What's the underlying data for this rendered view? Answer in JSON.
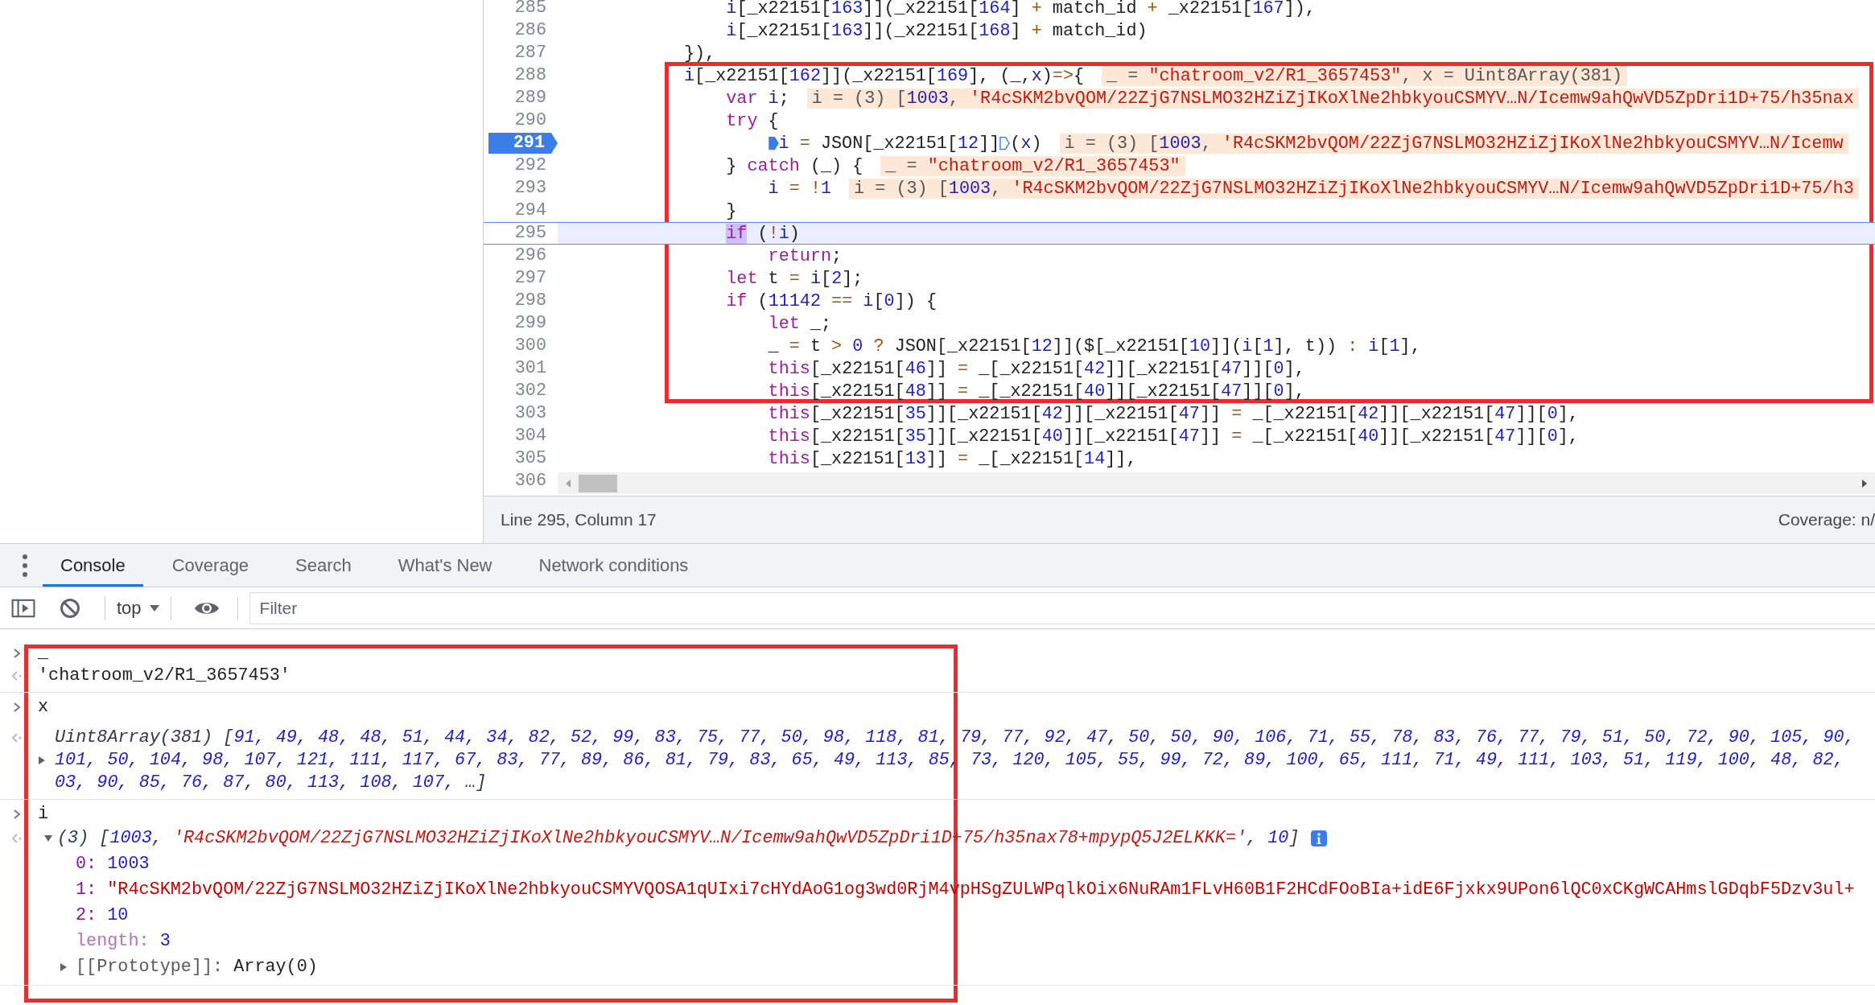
{
  "editor": {
    "lines": [
      {
        "children": [
          {
            "number": "285",
            "breakpoint": false,
            "current": false,
            "segments": [
              {
                "kind": "code",
                "tokens": [
                  {
                    "kind": "name",
                    "text": "i"
                  },
                  {
                    "kind": "plain",
                    "text": "[_x22151["
                  },
                  {
                    "kind": "num",
                    "text": "163"
                  },
                  {
                    "kind": "plain",
                    "text": "]](_x22151["
                  },
                  {
                    "kind": "num",
                    "text": "164"
                  },
                  {
                    "kind": "plain",
                    "text": "] "
                  },
                  {
                    "kind": "op",
                    "text": "+"
                  },
                  {
                    "kind": "plain",
                    "text": " match_id "
                  },
                  {
                    "kind": "op",
                    "text": "+"
                  },
                  {
                    "kind": "plain",
                    "text": " _x22151["
                  },
                  {
                    "kind": "num",
                    "text": "167"
                  },
                  {
                    "kind": "plain",
                    "text": "]),"
                  }
                ]
              }
            ]
          },
          {
            "number": "286",
            "breakpoint": false,
            "current": false,
            "segments": [
              {
                "kind": "code",
                "tokens": [
                  {
                    "kind": "name",
                    "text": "i"
                  },
                  {
                    "kind": "plain",
                    "text": "[_x22151["
                  },
                  {
                    "kind": "num",
                    "text": "163"
                  },
                  {
                    "kind": "plain",
                    "text": "]](_x22151["
                  },
                  {
                    "kind": "num",
                    "text": "168"
                  },
                  {
                    "kind": "plain",
                    "text": "] "
                  },
                  {
                    "kind": "op",
                    "text": "+"
                  },
                  {
                    "kind": "plain",
                    "text": " match_id)"
                  }
                ]
              }
            ]
          }
        ]
      },
      {
        "number": "287",
        "breakpoint": false,
        "current": false,
        "segments": [
          {
            "kind": "code",
            "tokens": [
              {
                "kind": "plain",
                "text": "}),"
              }
            ]
          }
        ]
      },
      {
        "number": "288",
        "breakpoint": false,
        "current": false,
        "segments": [
          {
            "kind": "code",
            "tokens": [
              {
                "kind": "name",
                "text": "i"
              },
              {
                "kind": "plain",
                "text": "[_x22151["
              },
              {
                "kind": "num",
                "text": "162"
              },
              {
                "kind": "plain",
                "text": "]](_x22151["
              },
              {
                "kind": "num",
                "text": "169"
              },
              {
                "kind": "plain",
                "text": "], (_,"
              },
              {
                "kind": "name",
                "text": "x"
              },
              {
                "kind": "plain",
                "text": ")"
              },
              {
                "kind": "op",
                "text": "=>"
              },
              {
                "kind": "plain",
                "text": "{"
              }
            ]
          }
        ],
        "inline_value": [
          {
            "kind": "plain",
            "text": "_ = "
          },
          {
            "kind": "str",
            "text": "\"chatroom_v2/R1_3657453\""
          },
          {
            "kind": "plain",
            "text": ", x = Uint8Array(381)"
          }
        ],
        "children": [
          {
            "number": "289",
            "breakpoint": false,
            "current": false,
            "segments": [
              {
                "kind": "code",
                "tokens": [
                  {
                    "kind": "kw",
                    "text": "var"
                  },
                  {
                    "kind": "name",
                    "text": " i"
                  },
                  {
                    "kind": "plain",
                    "text": ";"
                  }
                ]
              }
            ],
            "inline_value": [
              {
                "kind": "plain",
                "text": "i = (3) ["
              },
              {
                "kind": "num",
                "text": "1003"
              },
              {
                "kind": "plain",
                "text": ", "
              },
              {
                "kind": "str",
                "text": "'R4cSKM2bvQOM/22ZjG7NSLMO32HZiZjIKoXlNe2hbkyouCSMYV…N/Icemw9ahQwVD5ZpDri1D+75/h35nax"
              }
            ]
          },
          {
            "number": "290",
            "breakpoint": false,
            "current": false,
            "segments": [
              {
                "kind": "code",
                "tokens": [
                  {
                    "kind": "kw",
                    "text": "try"
                  },
                  {
                    "kind": "plain",
                    "text": " {"
                  }
                ]
              }
            ],
            "children": [
              {
                "number": "291",
                "breakpoint": true,
                "current": false,
                "segments": [
                  {
                    "kind": "marker",
                    "active": true
                  },
                  {
                    "kind": "code",
                    "tokens": [
                      {
                        "kind": "name",
                        "text": "i"
                      },
                      {
                        "kind": "op",
                        "text": " = "
                      },
                      {
                        "kind": "plain",
                        "text": "JSON[_x22151["
                      },
                      {
                        "kind": "num",
                        "text": "12"
                      },
                      {
                        "kind": "plain",
                        "text": "]]"
                      }
                    ]
                  },
                  {
                    "kind": "marker",
                    "active": false
                  },
                  {
                    "kind": "code",
                    "tokens": [
                      {
                        "kind": "plain",
                        "text": "("
                      },
                      {
                        "kind": "name",
                        "text": "x"
                      },
                      {
                        "kind": "plain",
                        "text": ")"
                      }
                    ]
                  }
                ],
                "inline_value": [
                  {
                    "kind": "plain",
                    "text": "i = (3) ["
                  },
                  {
                    "kind": "num",
                    "text": "1003"
                  },
                  {
                    "kind": "plain",
                    "text": ", "
                  },
                  {
                    "kind": "str",
                    "text": "'R4cSKM2bvQOM/22ZjG7NSLMO32HZiZjIKoXlNe2hbkyouCSMYV…N/Icemw"
                  }
                ]
              }
            ]
          },
          {
            "number": "292",
            "breakpoint": false,
            "current": false,
            "segments": [
              {
                "kind": "code",
                "tokens": [
                  {
                    "kind": "plain",
                    "text": "} "
                  },
                  {
                    "kind": "kw",
                    "text": "catch"
                  },
                  {
                    "kind": "plain",
                    "text": " (_) {"
                  }
                ]
              }
            ],
            "inline_value": [
              {
                "kind": "plain",
                "text": "_ = "
              },
              {
                "kind": "str",
                "text": "\"chatroom_v2/R1_3657453\""
              }
            ],
            "children": [
              {
                "number": "293",
                "breakpoint": false,
                "current": false,
                "segments": [
                  {
                    "kind": "code",
                    "tokens": [
                      {
                        "kind": "name",
                        "text": "i"
                      },
                      {
                        "kind": "op",
                        "text": " = !"
                      },
                      {
                        "kind": "num",
                        "text": "1"
                      }
                    ]
                  }
                ],
                "inline_value": [
                  {
                    "kind": "plain",
                    "text": "i = (3) ["
                  },
                  {
                    "kind": "num",
                    "text": "1003"
                  },
                  {
                    "kind": "plain",
                    "text": ", "
                  },
                  {
                    "kind": "str",
                    "text": "'R4cSKM2bvQOM/22ZjG7NSLMO32HZiZjIKoXlNe2hbkyouCSMYV…N/Icemw9ahQwVD5ZpDri1D+75/h3"
                  }
                ]
              }
            ]
          },
          {
            "number": "294",
            "breakpoint": false,
            "current": false,
            "segments": [
              {
                "kind": "code",
                "tokens": [
                  {
                    "kind": "plain",
                    "text": "}"
                  }
                ]
              }
            ]
          },
          {
            "number": "295",
            "breakpoint": false,
            "current": true,
            "segments": [
              {
                "kind": "code",
                "tokens": [
                  {
                    "kind": "paused",
                    "text": "if"
                  },
                  {
                    "kind": "plain",
                    "text": " ("
                  },
                  {
                    "kind": "op",
                    "text": "!"
                  },
                  {
                    "kind": "name",
                    "text": "i"
                  },
                  {
                    "kind": "plain",
                    "text": ")"
                  }
                ]
              }
            ],
            "children": [
              {
                "number": "296",
                "breakpoint": false,
                "current": false,
                "segments": [
                  {
                    "kind": "code",
                    "tokens": [
                      {
                        "kind": "kw",
                        "text": "return"
                      },
                      {
                        "kind": "plain",
                        "text": ";"
                      }
                    ]
                  }
                ]
              }
            ]
          },
          {
            "number": "297",
            "breakpoint": false,
            "current": false,
            "segments": [
              {
                "kind": "code",
                "tokens": [
                  {
                    "kind": "kw",
                    "text": "let"
                  },
                  {
                    "kind": "plain",
                    "text": " t "
                  },
                  {
                    "kind": "op",
                    "text": "="
                  },
                  {
                    "kind": "name",
                    "text": " i"
                  },
                  {
                    "kind": "plain",
                    "text": "["
                  },
                  {
                    "kind": "num",
                    "text": "2"
                  },
                  {
                    "kind": "plain",
                    "text": "];"
                  }
                ]
              }
            ]
          },
          {
            "number": "298",
            "breakpoint": false,
            "current": false,
            "segments": [
              {
                "kind": "code",
                "tokens": [
                  {
                    "kind": "kw",
                    "text": "if"
                  },
                  {
                    "kind": "plain",
                    "text": " ("
                  },
                  {
                    "kind": "num",
                    "text": "11142"
                  },
                  {
                    "kind": "op",
                    "text": " == "
                  },
                  {
                    "kind": "name",
                    "text": "i"
                  },
                  {
                    "kind": "plain",
                    "text": "["
                  },
                  {
                    "kind": "num",
                    "text": "0"
                  },
                  {
                    "kind": "plain",
                    "text": "]) {"
                  }
                ]
              }
            ],
            "children": [
              {
                "number": "299",
                "breakpoint": false,
                "current": false,
                "segments": [
                  {
                    "kind": "code",
                    "tokens": [
                      {
                        "kind": "kw",
                        "text": "let"
                      },
                      {
                        "kind": "plain",
                        "text": " _;"
                      }
                    ]
                  }
                ]
              },
              {
                "number": "300",
                "breakpoint": false,
                "current": false,
                "segments": [
                  {
                    "kind": "code",
                    "tokens": [
                      {
                        "kind": "plain",
                        "text": "_ "
                      },
                      {
                        "kind": "op",
                        "text": "="
                      },
                      {
                        "kind": "plain",
                        "text": " t "
                      },
                      {
                        "kind": "op",
                        "text": ">"
                      },
                      {
                        "kind": "num",
                        "text": " 0"
                      },
                      {
                        "kind": "op",
                        "text": " ?"
                      },
                      {
                        "kind": "plain",
                        "text": " JSON[_x22151["
                      },
                      {
                        "kind": "num",
                        "text": "12"
                      },
                      {
                        "kind": "plain",
                        "text": "]]($[_x22151["
                      },
                      {
                        "kind": "num",
                        "text": "10"
                      },
                      {
                        "kind": "plain",
                        "text": "]]("
                      },
                      {
                        "kind": "name",
                        "text": "i"
                      },
                      {
                        "kind": "plain",
                        "text": "["
                      },
                      {
                        "kind": "num",
                        "text": "1"
                      },
                      {
                        "kind": "plain",
                        "text": "], t)) "
                      },
                      {
                        "kind": "op",
                        "text": ":"
                      },
                      {
                        "kind": "name",
                        "text": " i"
                      },
                      {
                        "kind": "plain",
                        "text": "["
                      },
                      {
                        "kind": "num",
                        "text": "1"
                      },
                      {
                        "kind": "plain",
                        "text": "],"
                      }
                    ]
                  }
                ]
              },
              {
                "number": "301",
                "breakpoint": false,
                "current": false,
                "segments": [
                  {
                    "kind": "code",
                    "tokens": [
                      {
                        "kind": "kw",
                        "text": "this"
                      },
                      {
                        "kind": "plain",
                        "text": "[_x22151["
                      },
                      {
                        "kind": "num",
                        "text": "46"
                      },
                      {
                        "kind": "plain",
                        "text": "]] "
                      },
                      {
                        "kind": "op",
                        "text": "="
                      },
                      {
                        "kind": "plain",
                        "text": " _[_x22151["
                      },
                      {
                        "kind": "num",
                        "text": "42"
                      },
                      {
                        "kind": "plain",
                        "text": "]][_x22151["
                      },
                      {
                        "kind": "num",
                        "text": "47"
                      },
                      {
                        "kind": "plain",
                        "text": "]]["
                      },
                      {
                        "kind": "num",
                        "text": "0"
                      },
                      {
                        "kind": "plain",
                        "text": "],"
                      }
                    ]
                  }
                ]
              },
              {
                "number": "302",
                "breakpoint": false,
                "current": false,
                "segments": [
                  {
                    "kind": "code",
                    "tokens": [
                      {
                        "kind": "kw",
                        "text": "this"
                      },
                      {
                        "kind": "plain",
                        "text": "[_x22151["
                      },
                      {
                        "kind": "num",
                        "text": "48"
                      },
                      {
                        "kind": "plain",
                        "text": "]] "
                      },
                      {
                        "kind": "op",
                        "text": "="
                      },
                      {
                        "kind": "plain",
                        "text": " _[_x22151["
                      },
                      {
                        "kind": "num",
                        "text": "40"
                      },
                      {
                        "kind": "plain",
                        "text": "]][_x22151["
                      },
                      {
                        "kind": "num",
                        "text": "47"
                      },
                      {
                        "kind": "plain",
                        "text": "]]["
                      },
                      {
                        "kind": "num",
                        "text": "0"
                      },
                      {
                        "kind": "plain",
                        "text": "],"
                      }
                    ]
                  }
                ]
              },
              {
                "number": "303",
                "breakpoint": false,
                "current": false,
                "segments": [
                  {
                    "kind": "code",
                    "tokens": [
                      {
                        "kind": "kw",
                        "text": "this"
                      },
                      {
                        "kind": "plain",
                        "text": "[_x22151["
                      },
                      {
                        "kind": "num",
                        "text": "35"
                      },
                      {
                        "kind": "plain",
                        "text": "]][_x22151["
                      },
                      {
                        "kind": "num",
                        "text": "42"
                      },
                      {
                        "kind": "plain",
                        "text": "]][_x22151["
                      },
                      {
                        "kind": "num",
                        "text": "47"
                      },
                      {
                        "kind": "plain",
                        "text": "]] "
                      },
                      {
                        "kind": "op",
                        "text": "="
                      },
                      {
                        "kind": "plain",
                        "text": " _[_x22151["
                      },
                      {
                        "kind": "num",
                        "text": "42"
                      },
                      {
                        "kind": "plain",
                        "text": "]][_x22151["
                      },
                      {
                        "kind": "num",
                        "text": "47"
                      },
                      {
                        "kind": "plain",
                        "text": "]]["
                      },
                      {
                        "kind": "num",
                        "text": "0"
                      },
                      {
                        "kind": "plain",
                        "text": "],"
                      }
                    ]
                  }
                ]
              },
              {
                "number": "304",
                "breakpoint": false,
                "current": false,
                "segments": [
                  {
                    "kind": "code",
                    "tokens": [
                      {
                        "kind": "kw",
                        "text": "this"
                      },
                      {
                        "kind": "plain",
                        "text": "[_x22151["
                      },
                      {
                        "kind": "num",
                        "text": "35"
                      },
                      {
                        "kind": "plain",
                        "text": "]][_x22151["
                      },
                      {
                        "kind": "num",
                        "text": "40"
                      },
                      {
                        "kind": "plain",
                        "text": "]][_x22151["
                      },
                      {
                        "kind": "num",
                        "text": "47"
                      },
                      {
                        "kind": "plain",
                        "text": "]] "
                      },
                      {
                        "kind": "op",
                        "text": "="
                      },
                      {
                        "kind": "plain",
                        "text": " _[_x22151["
                      },
                      {
                        "kind": "num",
                        "text": "40"
                      },
                      {
                        "kind": "plain",
                        "text": "]][_x22151["
                      },
                      {
                        "kind": "num",
                        "text": "47"
                      },
                      {
                        "kind": "plain",
                        "text": "]]["
                      },
                      {
                        "kind": "num",
                        "text": "0"
                      },
                      {
                        "kind": "plain",
                        "text": "],"
                      }
                    ]
                  }
                ]
              },
              {
                "number": "305",
                "breakpoint": false,
                "current": false,
                "segments": [
                  {
                    "kind": "code",
                    "tokens": [
                      {
                        "kind": "kw",
                        "text": "this"
                      },
                      {
                        "kind": "plain",
                        "text": "[_x22151["
                      },
                      {
                        "kind": "num",
                        "text": "13"
                      },
                      {
                        "kind": "plain",
                        "text": "]] "
                      },
                      {
                        "kind": "op",
                        "text": "="
                      },
                      {
                        "kind": "plain",
                        "text": " _[_x22151["
                      },
                      {
                        "kind": "num",
                        "text": "14"
                      },
                      {
                        "kind": "plain",
                        "text": "]],"
                      }
                    ]
                  }
                ]
              }
            ]
          }
        ]
      },
      {
        "number": "306",
        "breakpoint": false,
        "current": false
      }
    ]
  },
  "status_bar": {
    "position": "Line 295, Column 17",
    "coverage": "Coverage: n/"
  },
  "drawer": {
    "tabs": [
      {
        "label": "Console",
        "selected": true
      },
      {
        "label": "Coverage",
        "selected": false
      },
      {
        "label": "Search",
        "selected": false
      },
      {
        "label": "What's New",
        "selected": false
      },
      {
        "label": "Network conditions",
        "selected": false
      }
    ],
    "context": "top",
    "filter_placeholder": "Filter"
  },
  "console": {
    "entries": [
      {
        "input": "_",
        "result": {
          "kind": "string",
          "text": "'chatroom_v2/R1_3657453'"
        }
      },
      {
        "input": "x",
        "result": {
          "kind": "preview",
          "expanded": false,
          "lines": [
            [
              {
                "kind": "dim",
                "text": "Uint8Array(381) ["
              },
              {
                "kind": "num",
                "text": "91, 49, 48, 48, 51, 44, 34, 82, 52, 99, 83, 75, 77, 50, 98, 118, 81, 79, 77, 92, 47, 50, 50, 90, 106, 71, 55, 78, 83, 76, 77, 79, 51, 50, 72, 90, 105, 90,"
              }
            ],
            [
              {
                "kind": "num",
                "text": "101, 50, 104, 98, 107, 121, 111, 117, 67, 83, 77, 89, 86, 81, 79, 83, 65, 49, 113, 85, 73, 120, 105, 55, 99, 72, 89, 100, 65, 111, 71, 49, 111, 103, 51, 119, 100, 48, 82,"
              }
            ],
            [
              {
                "kind": "num",
                "text": "03, 90, 85, 76, 87, 80, 113, 108, 107, "
              },
              {
                "kind": "dim",
                "text": "…]"
              }
            ]
          ]
        }
      },
      {
        "input": "i",
        "result": {
          "kind": "tree",
          "expanded": true,
          "preview": [
            {
              "kind": "dim",
              "text": "(3) ["
            },
            {
              "kind": "num",
              "text": "1003"
            },
            {
              "kind": "dim",
              "text": ", "
            },
            {
              "kind": "str",
              "text": "'R4cSKM2bvQOM/22ZjG7NSLMO32HZiZjIKoXlNe2hbkyouCSMYV…N/Icemw9ahQwVD5ZpDri1D+75/h35nax78+mpypQ5J2ELKKK='"
            },
            {
              "kind": "dim",
              "text": ", "
            },
            {
              "kind": "num",
              "text": "10"
            },
            {
              "kind": "dim",
              "text": "]"
            }
          ],
          "properties": [
            {
              "kind": "index",
              "key": "0:",
              "value": {
                "kind": "num",
                "text": "1003"
              }
            },
            {
              "kind": "index",
              "key": "1:",
              "value": {
                "kind": "str",
                "text": "\"R4cSKM2bvQOM/22ZjG7NSLMO32HZiZjIKoXlNe2hbkyouCSMYVQOSA1qUIxi7cHYdAoG1og3wd0RjM4vpHSgZULWPqlkOix6NuRAm1FLvH60B1F2HCdFOoBIa+idE6Fjxkx9UPon6lQC0xCKgWCAHmslGDqbF5Dzv3ul+"
              }
            },
            {
              "kind": "index",
              "key": "2:",
              "value": {
                "kind": "num",
                "text": "10"
              }
            },
            {
              "kind": "meta",
              "key": "length:",
              "value": {
                "kind": "num",
                "text": "3"
              }
            },
            {
              "kind": "internal",
              "key": "[[Prototype]]:",
              "value": {
                "kind": "plain",
                "text": "Array(0)"
              },
              "expanded": false
            }
          ]
        }
      }
    ]
  }
}
